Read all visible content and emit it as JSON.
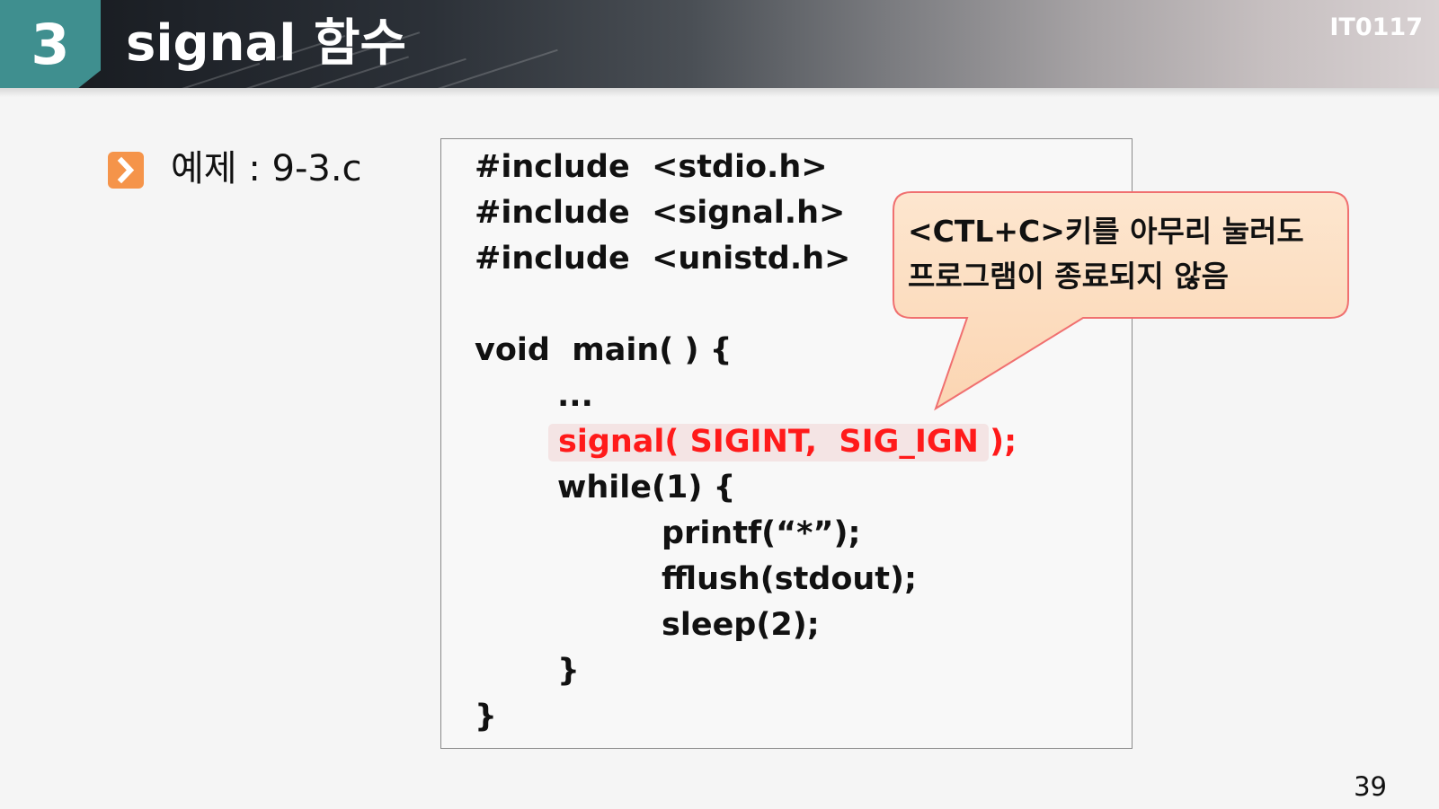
{
  "header": {
    "section_number": "3",
    "title": "signal 함수",
    "course_code": "IT0117"
  },
  "bullet": {
    "icon": "chevron-right-icon",
    "label": "예제 : 9-3.c"
  },
  "code": {
    "lines": [
      "#include  <stdio.h>",
      "#include  <signal.h>",
      "#include  <unistd.h>",
      "void  main( ) {",
      "...",
      "signal( SIGINT,  SIG_IGN );",
      "while(1) {",
      "printf(“*”);",
      "fflush(stdout);",
      "sleep(2);",
      "}",
      "}"
    ],
    "highlight_color": "#ff1a1a"
  },
  "callout": {
    "line1": "<CTL+C>키를 아무리 눌러도",
    "line2": "프로그램이 종료되지 않음",
    "fill_color": "#fde0c4",
    "border_color": "#f07070"
  },
  "page_number": "39",
  "colors": {
    "accent": "#3f8f8f",
    "bullet": "#f5944a"
  }
}
